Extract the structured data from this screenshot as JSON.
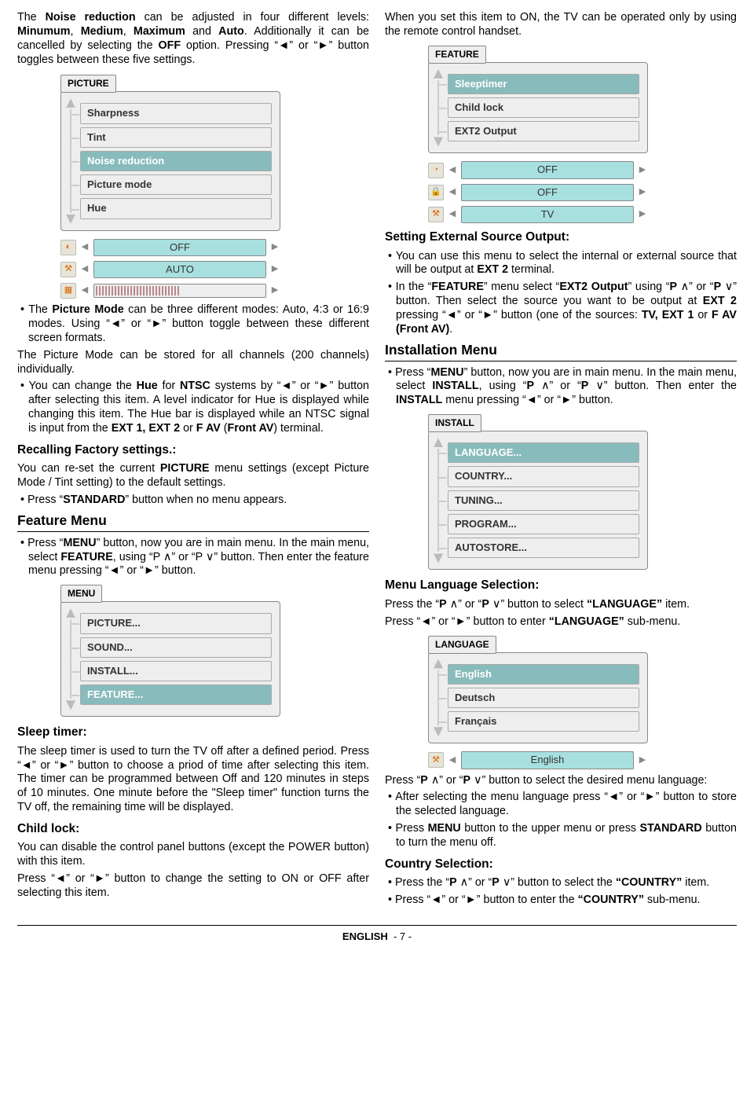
{
  "left": {
    "intro": "The Noise reduction can be adjusted in four different levels: Minumum, Medium, Maximum and Auto. Additionally it can be cancelled by selecting the OFF option. Pressing \"◄\" or \"►\" button toggles between these five settings.",
    "picture_tab": "PICTURE",
    "picture_items": [
      "Sharpness",
      "Tint",
      "Noise reduction",
      "Picture mode",
      "Hue"
    ],
    "val_off": "OFF",
    "val_auto": "AUTO",
    "pm_para": "The Picture Mode can be three different modes: Auto, 4:3 or 16:9 modes. Using \"◄\" or \"►\" button toggle between these different screen formats.",
    "pm_para2": "The Picture Mode can be stored for all channels (200 channels) individually.",
    "hue_para": "You can change the Hue for NTSC systems by \"◄\" or \"►\" button after selecting this item. A level indicator for Hue is displayed while changing this item. The Hue bar is displayed while an NTSC signal is input from the EXT 1, EXT 2 or F AV (Front AV) terminal.",
    "recall_h": "Recalling Factory settings.:",
    "recall_p": "You can re-set the current PICTURE menu settings (except Picture Mode / Tint setting) to the default settings.",
    "recall_b": "Press \"STANDARD\" button when no menu appears.",
    "feature_h": "Feature Menu",
    "feature_p": "Press \"MENU\" button, now you are in main menu. In the main menu, select FEATURE, using \"P ∧\" or \"P ∨\" button. Then enter the feature menu pressing \"◄\" or \"►\" button.",
    "menu_tab": "MENU",
    "menu_items": [
      "PICTURE...",
      "SOUND...",
      "INSTALL...",
      "FEATURE..."
    ],
    "sleep_h": "Sleep timer:",
    "sleep_p": "The sleep timer is used to turn the TV off after a defined period. Press \"◄\" or \"►\" button to choose a priod of time after selecting this item. The timer can be programmed between Off and 120 minutes in steps of 10 minutes. One minute before the \"Sleep timer\" function turns the TV off, the remaining time will be displayed.",
    "child_h": "Child lock:",
    "child_p1": "You can disable the control panel buttons (except the POWER button) with this item.",
    "child_p2": "Press \"◄\" or \"►\" button to change the setting to ON or OFF after selecting this item."
  },
  "right": {
    "intro": "When you set this item to ON, the TV can be operated only by using the remote control handset.",
    "feature_tab": "FEATURE",
    "feature_items": [
      "Sleeptimer",
      "Child lock",
      "EXT2 Output"
    ],
    "val_off": "OFF",
    "val_off2": "OFF",
    "val_tv": "TV",
    "ext_h": "Setting External Source Output:",
    "ext_b1": "You can use this menu to select the internal or external source that will be output at EXT 2 terminal.",
    "ext_b2": "In the \"FEATURE\" menu select \"EXT2 Output\" using \"P ∧\" or \"P ∨\" button. Then select the source you want to be output at EXT 2 pressing \"◄\" or \"►\" button (one of the sources: TV, EXT 1 or F AV (Front AV).",
    "install_h": "Installation Menu",
    "install_p": "Press \"MENU\" button, now you are in main menu. In the main menu, select INSTALL, using \"P ∧\" or \"P ∨\" button. Then enter the INSTALL menu pressing \"◄\" or \"►\" button.",
    "install_tab": "INSTALL",
    "install_items": [
      "LANGUAGE...",
      "COUNTRY...",
      "TUNING...",
      "PROGRAM...",
      "AUTOSTORE..."
    ],
    "lang_h": "Menu Language Selection:",
    "lang_p1": "Press the \"P ∧\" or \"P ∨\" button to select \"LANGUAGE\" item.",
    "lang_p2": "Press \"◄\" or \"►\" button to enter \"LANGUAGE\" sub-menu.",
    "lang_tab": "LANGUAGE",
    "lang_items": [
      "English",
      "Deutsch",
      "Français"
    ],
    "val_english": "English",
    "lang_p3": "Press \"P ∧\" or \"P ∨\" button to select the desired menu language:",
    "lang_b1": "After selecting the menu language press \"◄\" or \"►\" button to store the selected language.",
    "lang_b2": "Press MENU button to the upper menu or press STANDARD button to turn the menu off.",
    "country_h": "Country Selection:",
    "country_b1": "Press the \"P ∧\" or \"P ∨\" button to select the \"COUNTRY\" item.",
    "country_b2": "Press \"◄\" or \"►\" button to enter the \"COUNTRY\" sub-menu."
  },
  "footer": {
    "lang": "ENGLISH",
    "page": "- 7 -"
  }
}
